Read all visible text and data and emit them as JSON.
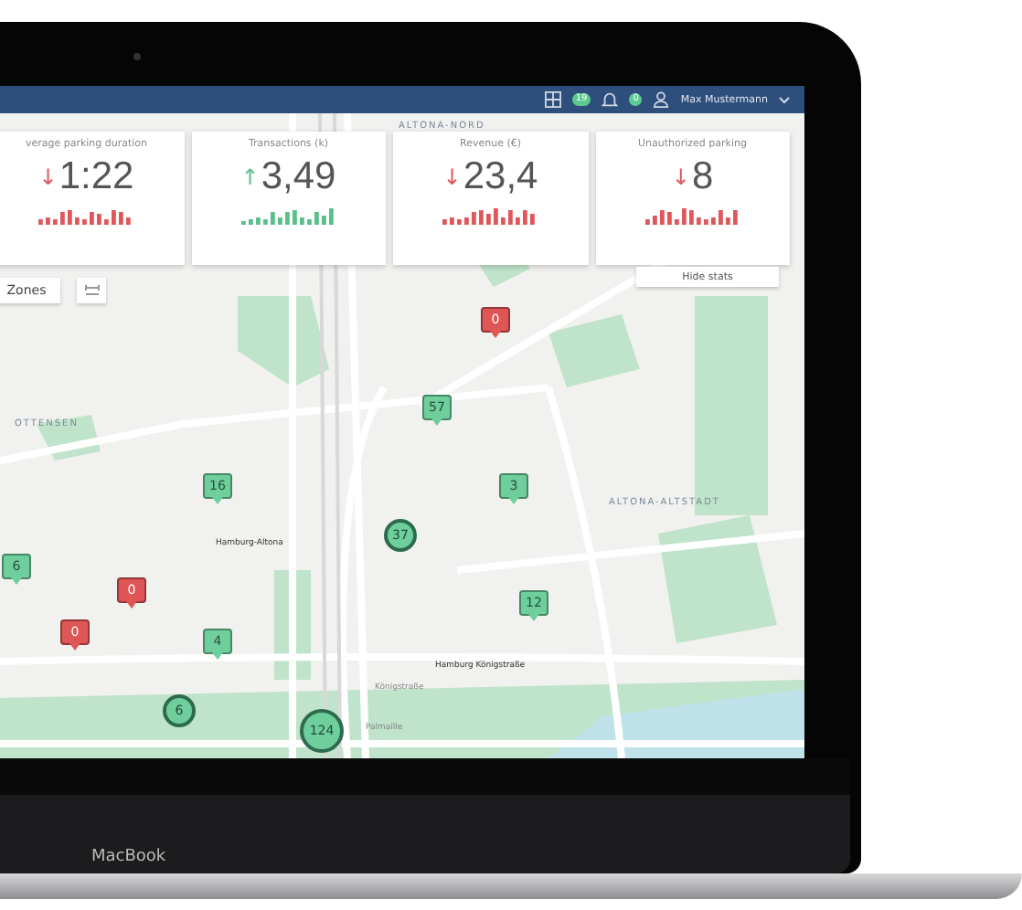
{
  "header": {
    "apps_badge": "19",
    "notifications_badge": "0",
    "user_name": "Max Mustermann"
  },
  "stats": [
    {
      "title": "verage parking duration",
      "value": "1:22",
      "rising": false,
      "arrow": "↓"
    },
    {
      "title": "Transactions (k)",
      "value": "3,49",
      "rising": true,
      "arrow": "↑"
    },
    {
      "title": "Revenue (€)",
      "value": "23,4",
      "rising": false,
      "arrow": "↓"
    },
    {
      "title": "Unauthorized parking",
      "value": "8",
      "rising": false,
      "arrow": "↓"
    }
  ],
  "hide_stats_button": "Hide stats",
  "zones_button": "Zones",
  "map": {
    "labels": [
      {
        "text": "ALTONA-NORD",
        "kind": "district"
      },
      {
        "text": "OTTENSEN",
        "kind": "district"
      },
      {
        "text": "ALTONA-ALTSTADT",
        "kind": "district"
      },
      {
        "text": "Hamburg-Altona",
        "kind": "station"
      },
      {
        "text": "Hamburg Königstraße",
        "kind": "station"
      },
      {
        "text": "Königstraße",
        "kind": "street"
      },
      {
        "text": "Palmaille",
        "kind": "street"
      }
    ],
    "pins": [
      {
        "kind": "marker",
        "alert": true,
        "count": "0"
      },
      {
        "kind": "marker",
        "alert": false,
        "count": "57"
      },
      {
        "kind": "marker",
        "alert": false,
        "count": "16"
      },
      {
        "kind": "marker",
        "alert": false,
        "count": "3"
      },
      {
        "kind": "cluster",
        "alert": false,
        "count": "37"
      },
      {
        "kind": "marker",
        "alert": false,
        "count": "6"
      },
      {
        "kind": "marker",
        "alert": true,
        "count": "0"
      },
      {
        "kind": "marker",
        "alert": true,
        "count": "0"
      },
      {
        "kind": "marker",
        "alert": false,
        "count": "4"
      },
      {
        "kind": "marker",
        "alert": false,
        "count": "12"
      },
      {
        "kind": "cluster",
        "alert": false,
        "count": "6"
      },
      {
        "kind": "cluster",
        "alert": false,
        "count": "124"
      }
    ]
  },
  "device": {
    "brand": "MacBook"
  }
}
